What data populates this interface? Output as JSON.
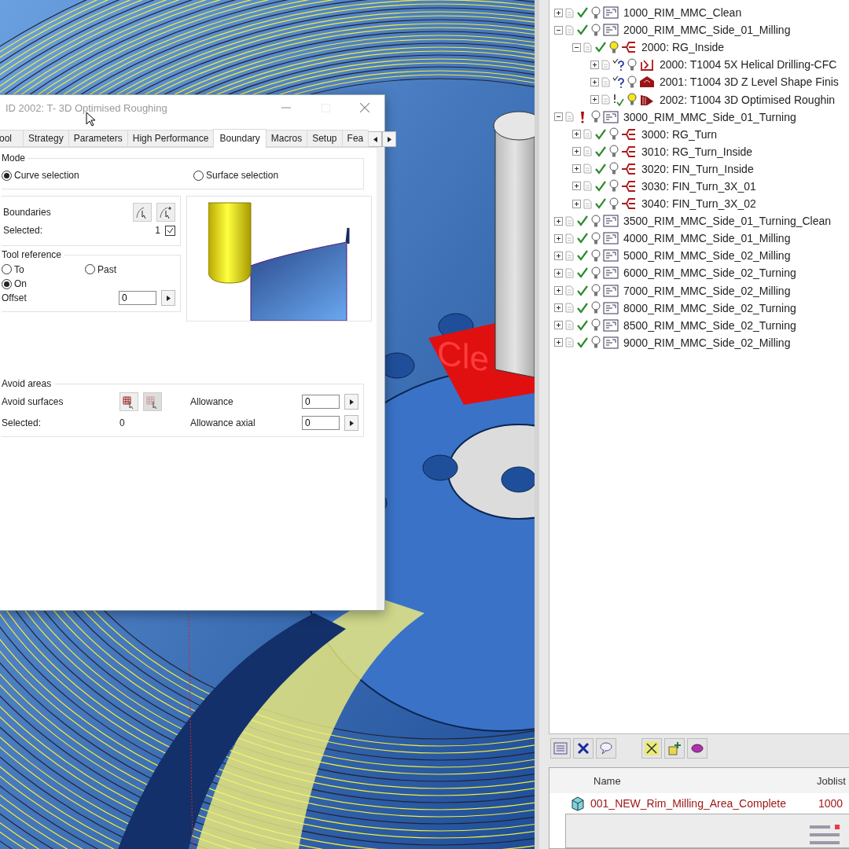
{
  "viewport": {
    "label": "Cle"
  },
  "dialog": {
    "title": "ID 2002: T- 3D Optimised Roughing",
    "tabs": [
      {
        "label": "ool",
        "selected": false
      },
      {
        "label": "Strategy",
        "selected": false
      },
      {
        "label": "Parameters",
        "selected": false
      },
      {
        "label": "High Performance",
        "selected": false
      },
      {
        "label": "Boundary",
        "selected": true
      },
      {
        "label": "Macros",
        "selected": false
      },
      {
        "label": "Setup",
        "selected": false
      },
      {
        "label": "Fea",
        "selected": false
      }
    ],
    "mode": {
      "title": "Mode",
      "options": [
        {
          "label": "Curve selection",
          "selected": true
        },
        {
          "label": "Surface selection",
          "selected": false
        }
      ]
    },
    "boundaries": {
      "label": "Boundaries",
      "selected_label": "Selected:",
      "selected_count": "1",
      "confirmed": true
    },
    "tool_reference": {
      "title": "Tool reference",
      "options": [
        {
          "label": "To",
          "selected": false
        },
        {
          "label": "Past",
          "selected": false
        },
        {
          "label": "On",
          "selected": true
        }
      ],
      "offset_label": "Offset",
      "offset_value": "0"
    },
    "avoid_areas": {
      "title": "Avoid areas",
      "surfaces_label": "Avoid surfaces",
      "selected_label": "Selected:",
      "selected_count": "0",
      "allowance_label": "Allowance",
      "allowance_value": "0",
      "axial_label": "Allowance axial",
      "axial_value": "0"
    }
  },
  "tree": [
    {
      "label": "1000_RIM_MMC_Clean",
      "expanded": false,
      "checked": true,
      "unverified": false,
      "flagged": false,
      "lit": false,
      "kind": "setup"
    },
    {
      "label": "2000_RIM_MMC_Side_01_Milling",
      "expanded": true,
      "checked": true,
      "unverified": false,
      "flagged": false,
      "lit": false,
      "kind": "setup",
      "children": [
        {
          "label": "2000: RG_Inside",
          "expanded": true,
          "checked": true,
          "unverified": false,
          "flagged": false,
          "lit": true,
          "kind": "group",
          "children": [
            {
              "label": "2000: T1004 5X Helical Drilling-CFC",
              "expanded": false,
              "checked": true,
              "unverified": true,
              "flagged": false,
              "lit": false,
              "kind": "drilling"
            },
            {
              "label": "2001: T1004 3D Z Level Shape Finis",
              "expanded": false,
              "checked": true,
              "unverified": true,
              "flagged": false,
              "lit": false,
              "kind": "zlevel"
            },
            {
              "label": "2002: T1004 3D Optimised Roughin",
              "expanded": false,
              "checked": true,
              "unverified": false,
              "flagged": true,
              "lit": true,
              "kind": "roughing"
            }
          ]
        }
      ]
    },
    {
      "label": "3000_RIM_MMC_Side_01_Turning",
      "expanded": true,
      "checked": false,
      "unverified": false,
      "flagged": true,
      "lit": false,
      "kind": "setup",
      "children": [
        {
          "label": "3000: RG_Turn",
          "expanded": false,
          "checked": true,
          "unverified": false,
          "flagged": false,
          "lit": false,
          "kind": "group"
        },
        {
          "label": "3010: RG_Turn_Inside",
          "expanded": false,
          "checked": true,
          "unverified": false,
          "flagged": false,
          "lit": false,
          "kind": "group"
        },
        {
          "label": "3020: FIN_Turn_Inside",
          "expanded": false,
          "checked": true,
          "unverified": false,
          "flagged": false,
          "lit": false,
          "kind": "group"
        },
        {
          "label": "3030: FIN_Turn_3X_01",
          "expanded": false,
          "checked": true,
          "unverified": false,
          "flagged": false,
          "lit": false,
          "kind": "group"
        },
        {
          "label": "3040: FIN_Turn_3X_02",
          "expanded": false,
          "checked": true,
          "unverified": false,
          "flagged": false,
          "lit": false,
          "kind": "group"
        }
      ]
    },
    {
      "label": "3500_RIM_MMC_Side_01_Turning_Clean",
      "expanded": false,
      "checked": true,
      "unverified": false,
      "flagged": false,
      "lit": false,
      "kind": "setup"
    },
    {
      "label": "4000_RIM_MMC_Side_01_Milling",
      "expanded": false,
      "checked": true,
      "unverified": false,
      "flagged": false,
      "lit": false,
      "kind": "setup"
    },
    {
      "label": "5000_RIM_MMC_Side_02_Milling",
      "expanded": false,
      "checked": true,
      "unverified": false,
      "flagged": false,
      "lit": false,
      "kind": "setup"
    },
    {
      "label": "6000_RIM_MMC_Side_02_Turning",
      "expanded": false,
      "checked": true,
      "unverified": false,
      "flagged": false,
      "lit": false,
      "kind": "setup"
    },
    {
      "label": "7000_RIM_MMC_Side_02_Milling",
      "expanded": false,
      "checked": true,
      "unverified": false,
      "flagged": false,
      "lit": false,
      "kind": "setup"
    },
    {
      "label": "8000_RIM_MMC_Side_02_Turning",
      "expanded": false,
      "checked": true,
      "unverified": false,
      "flagged": false,
      "lit": false,
      "kind": "setup"
    },
    {
      "label": "8500_RIM_MMC_Side_02_Turning",
      "expanded": false,
      "checked": true,
      "unverified": false,
      "flagged": false,
      "lit": false,
      "kind": "setup"
    },
    {
      "label": "9000_RIM_MMC_Side_02_Milling",
      "expanded": false,
      "checked": true,
      "unverified": false,
      "flagged": false,
      "lit": false,
      "kind": "setup"
    }
  ],
  "list": {
    "columns": [
      "Name",
      "Joblist"
    ],
    "rows": [
      {
        "name": "001_NEW_Rim_Milling_Area_Complete",
        "joblist": "1000"
      }
    ]
  }
}
